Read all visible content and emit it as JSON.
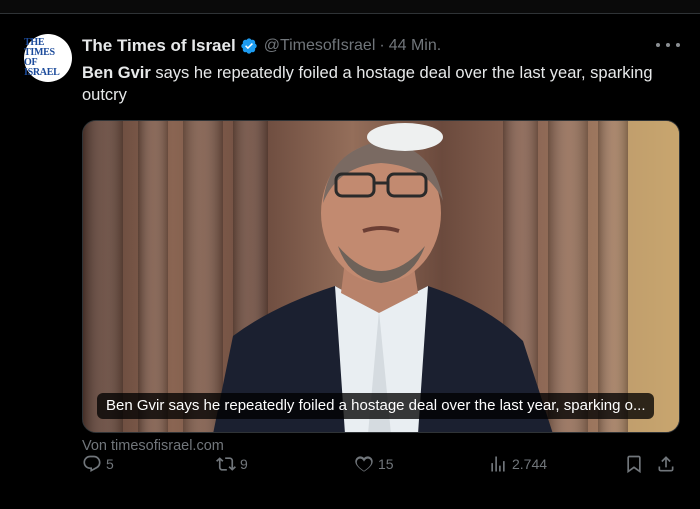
{
  "tweet": {
    "avatar_lines": [
      "THE TIMES",
      "OF ISRAEL"
    ],
    "author_name": "The Times of Israel",
    "handle": "@TimesofIsrael",
    "separator": "·",
    "time": "44 Min.",
    "text_bold": "Ben Gvir",
    "text_rest": " says he repeatedly foiled a hostage deal over the last year, sparking outcry",
    "media_caption": "Ben Gvir says he repeatedly foiled a hostage deal over the last year, sparking o...",
    "source": "Von timesofisrael.com"
  },
  "actions": {
    "reply_count": "5",
    "retweet_count": "9",
    "like_count": "15",
    "views_count": "2.744"
  },
  "icons": {
    "verified": "verified-badge-icon",
    "more": "more-dots-icon",
    "reply": "reply-icon",
    "retweet": "retweet-icon",
    "like": "heart-icon",
    "views": "views-icon",
    "bookmark": "bookmark-icon",
    "share": "share-icon"
  },
  "colors": {
    "background": "#000000",
    "text": "#e7e9ea",
    "secondary": "#71767b",
    "verified_blue": "#1d9bf0",
    "avatar_brand": "#1c4b9b"
  }
}
